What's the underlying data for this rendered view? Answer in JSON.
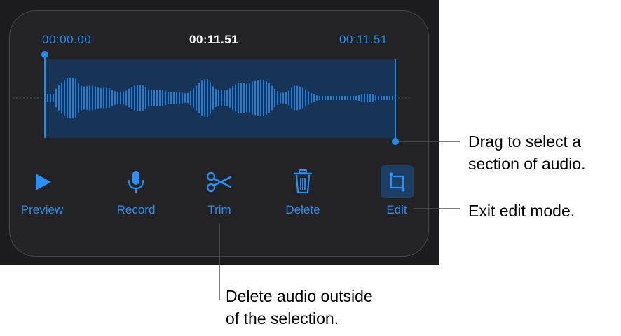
{
  "timeline": {
    "start_time": "00:00.00",
    "current_time": "00:11.51",
    "end_time": "00:11.51"
  },
  "controls": {
    "preview_label": "Preview",
    "record_label": "Record",
    "trim_label": "Trim",
    "delete_label": "Delete",
    "edit_label": "Edit"
  },
  "callouts": {
    "drag_line1": "Drag to select a",
    "drag_line2": "section of audio.",
    "exit_edit": "Exit edit mode.",
    "trim_line1": "Delete audio outside",
    "trim_line2": "of the selection."
  },
  "colors": {
    "accent": "#1f8ef1",
    "panel": "#1c1c1e",
    "card": "#232325",
    "selection": "#173456"
  },
  "icons": [
    "play-icon",
    "microphone-icon",
    "scissors-icon",
    "trash-icon",
    "crop-icon"
  ]
}
